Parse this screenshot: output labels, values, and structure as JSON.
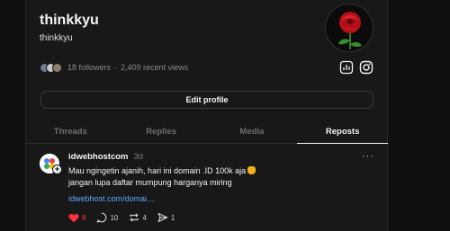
{
  "profile": {
    "name": "thinkkyu",
    "handle": "thinkkyu",
    "followers": "18 followers",
    "separator": "·",
    "views": "2,409 recent views",
    "edit_label": "Edit profile"
  },
  "tabs": [
    {
      "label": "Threads",
      "active": false
    },
    {
      "label": "Replies",
      "active": false
    },
    {
      "label": "Media",
      "active": false
    },
    {
      "label": "Reposts",
      "active": true
    }
  ],
  "post": {
    "username": "idwebhostcom",
    "time": "3d",
    "more": "···",
    "line1": "Mau ngingetin ajanih, hari ini domain .ID 100k aja",
    "line2": "jangan lupa daftar mumpung harganya miring",
    "link": "idwebhost.com/domai…",
    "likes": "8",
    "replies": "10",
    "reposts": "4",
    "shares": "1"
  },
  "colors": {
    "background": "#101010",
    "panel": "#181818",
    "link": "#5aa9ff",
    "like": "#ff3040"
  },
  "icons": [
    "rose-avatar",
    "insights-icon",
    "instagram-icon",
    "heart-icon",
    "comment-icon",
    "repost-icon",
    "share-icon",
    "more-icon"
  ]
}
